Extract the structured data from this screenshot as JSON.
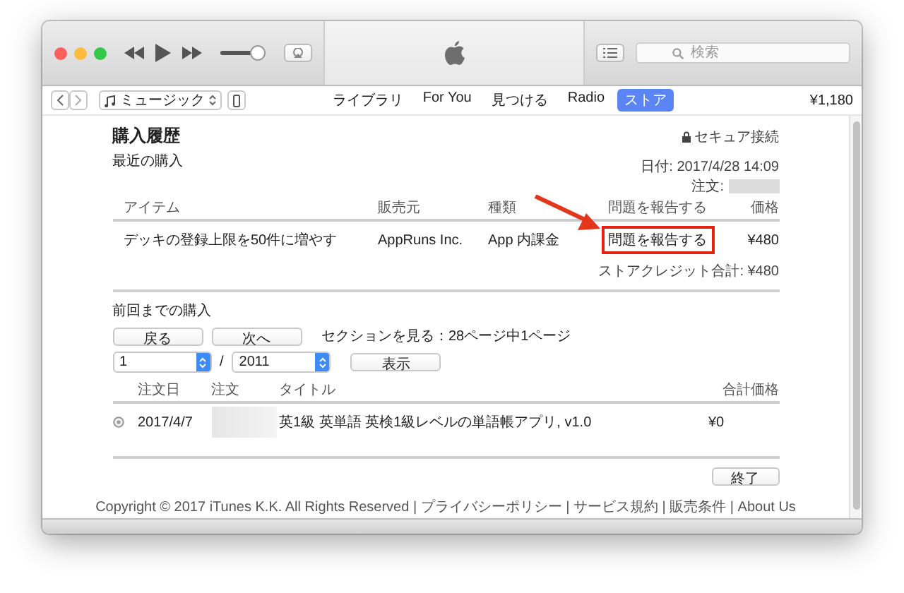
{
  "toolbar": {
    "volume": {
      "level": 0.85
    },
    "search": {
      "placeholder": "検索"
    }
  },
  "nav": {
    "library_picker": "ミュージック",
    "tabs": [
      {
        "label": "ライブラリ",
        "selected": false
      },
      {
        "label": "For You",
        "selected": false
      },
      {
        "label": "見つける",
        "selected": false
      },
      {
        "label": "Radio",
        "selected": false
      },
      {
        "label": "ストア",
        "selected": true
      }
    ],
    "balance": "¥1,180"
  },
  "page": {
    "title": "購入履歴",
    "secure": "セキュア接続",
    "recent_heading": "最近の購入",
    "date": "日付: 2017/4/28 14:09",
    "order_label": "注文:",
    "recent_table": {
      "columns": [
        "アイテム",
        "販売元",
        "種類",
        "問題を報告する",
        "価格"
      ],
      "rows": [
        {
          "item": "デッキの登録上限を50件に増やす",
          "seller": "AppRuns Inc.",
          "type": "App 内課金",
          "report": "問題を報告する",
          "price": "¥480",
          "highlighted": true
        }
      ]
    },
    "credit_total": "ストアクレジット合計: ¥480",
    "previous_heading": "前回までの購入",
    "back_button": "戻る",
    "next_button": "次へ",
    "section_info": "セクションを見る：28ページ中1ページ",
    "month": "1",
    "separator": "/",
    "year": "2011",
    "show_button": "表示",
    "history_table": {
      "columns": [
        "注文日",
        "注文",
        "タイトル",
        "合計価格"
      ],
      "rows": [
        {
          "date": "2017/4/7",
          "title": "英1級 英単語 英検1級レベルの単語帳アプリ, v1.0",
          "total": "¥0"
        }
      ]
    },
    "done_button": "終了",
    "footer": "Copyright © 2017 iTunes K.K. All Rights Reserved | プライバシーポリシー | サービス規約 | 販売条件 | About Us"
  }
}
